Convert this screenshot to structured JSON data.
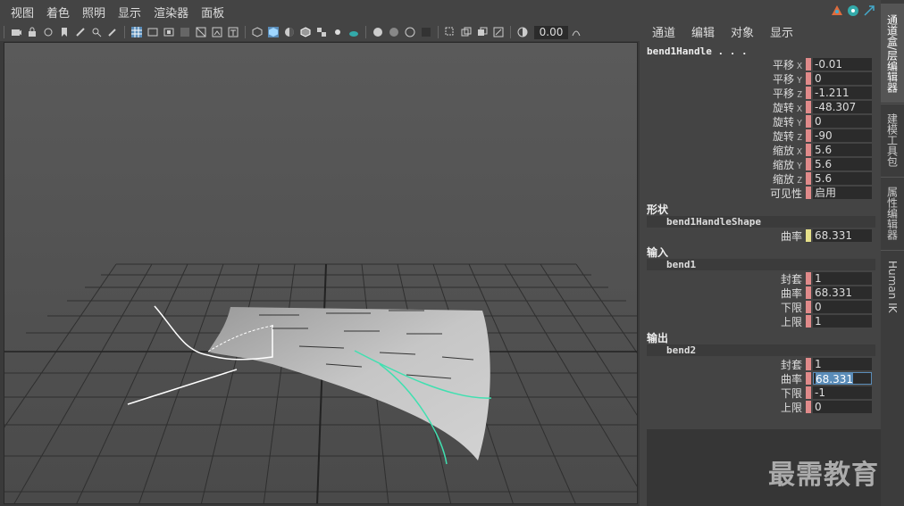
{
  "viewport": {
    "menus": [
      "视图",
      "着色",
      "照明",
      "显示",
      "渲染器",
      "面板"
    ],
    "toolbar_value": "0.00"
  },
  "channel_box": {
    "menus": [
      "通道",
      "编辑",
      "对象",
      "显示"
    ],
    "node_name": "bend1Handle . . .",
    "transform_attrs": [
      {
        "label": "平移",
        "axis": "X",
        "value": "-0.01"
      },
      {
        "label": "平移",
        "axis": "Y",
        "value": "0"
      },
      {
        "label": "平移",
        "axis": "Z",
        "value": "-1.211"
      },
      {
        "label": "旋转",
        "axis": "X",
        "value": "-48.307"
      },
      {
        "label": "旋转",
        "axis": "Y",
        "value": "0"
      },
      {
        "label": "旋转",
        "axis": "Z",
        "value": "-90"
      },
      {
        "label": "缩放",
        "axis": "X",
        "value": "5.6"
      },
      {
        "label": "缩放",
        "axis": "Y",
        "value": "5.6"
      },
      {
        "label": "缩放",
        "axis": "Z",
        "value": "5.6"
      },
      {
        "label": "可见性",
        "axis": "",
        "value": "启用"
      }
    ],
    "shape_section": {
      "title": "形状",
      "node": "bend1HandleShape",
      "attrs": [
        {
          "label": "曲率",
          "value": "68.331"
        }
      ]
    },
    "input_section": {
      "title": "输入",
      "node": "bend1",
      "attrs": [
        {
          "label": "封套",
          "value": "1"
        },
        {
          "label": "曲率",
          "value": "68.331"
        },
        {
          "label": "下限",
          "value": "0"
        },
        {
          "label": "上限",
          "value": "1"
        }
      ]
    },
    "output_section": {
      "title": "输出",
      "node": "bend2",
      "attrs": [
        {
          "label": "封套",
          "value": "1"
        },
        {
          "label": "曲率",
          "value": "68.331"
        },
        {
          "label": "下限",
          "value": "-1"
        },
        {
          "label": "上限",
          "value": "0"
        }
      ]
    }
  },
  "side_tabs": [
    "通道盒/层编辑器",
    "建模工具包",
    "属性编辑器",
    "Human IK"
  ],
  "watermark": "最需教育",
  "colors": {
    "keyed_marker": "#e08a8a",
    "shape_marker": "#e6e08a",
    "selection_blue": "#5a8cb8",
    "deformer_curve": "#40e0b0"
  }
}
